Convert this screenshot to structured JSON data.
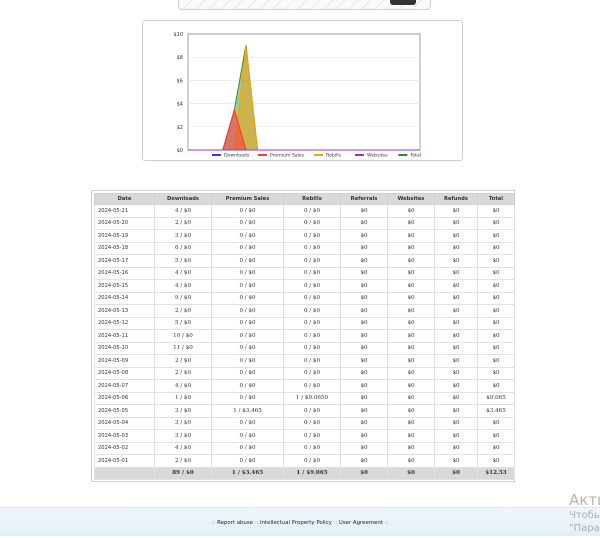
{
  "chart_data": {
    "type": "area",
    "x": [
      "2024-05-01",
      "2024-05-02",
      "2024-05-03",
      "2024-05-04",
      "2024-05-05",
      "2024-05-06",
      "2024-05-07",
      "2024-05-08",
      "2024-05-09",
      "2024-05-10",
      "2024-05-11",
      "2024-05-12",
      "2024-05-13",
      "2024-05-14",
      "2024-05-15",
      "2024-05-16",
      "2024-05-17",
      "2024-05-18",
      "2024-05-19",
      "2024-05-20",
      "2024-05-21"
    ],
    "series": [
      {
        "name": "Downloads",
        "color": "#3333ff",
        "values": [
          0,
          0,
          0,
          0,
          0,
          0,
          0,
          0,
          0,
          0,
          0,
          0,
          0,
          0,
          0,
          0,
          0,
          0,
          0,
          0,
          0
        ]
      },
      {
        "name": "Premium Sales",
        "color": "#ff3333",
        "values": [
          0,
          0,
          0,
          0,
          3.465,
          0,
          0,
          0,
          0,
          0,
          0,
          0,
          0,
          0,
          0,
          0,
          0,
          0,
          0,
          0,
          0
        ]
      },
      {
        "name": "Rebills",
        "color": "#f0a30a",
        "values": [
          0,
          0,
          0,
          0,
          0,
          9.065,
          0,
          0,
          0,
          0,
          0,
          0,
          0,
          0,
          0,
          0,
          0,
          0,
          0,
          0,
          0
        ]
      },
      {
        "name": "Websites",
        "color": "#9933cc",
        "values": [
          0,
          0,
          0,
          0,
          0,
          0,
          0,
          0,
          0,
          0,
          0,
          0,
          0,
          0,
          0,
          0,
          0,
          0,
          0,
          0,
          0
        ]
      },
      {
        "name": "Total",
        "color": "#2e8b2e",
        "values": [
          0,
          0,
          0,
          0,
          3.465,
          9.065,
          0,
          0,
          0,
          0,
          0,
          0,
          0,
          0,
          0,
          0,
          0,
          0,
          0,
          0,
          0
        ]
      }
    ],
    "yticks": [
      "$0",
      "$2",
      "$4",
      "$6",
      "$8",
      "$10"
    ],
    "ylim": [
      0,
      10
    ],
    "legend_position": "bottom"
  },
  "table": {
    "headers": [
      "Date",
      "Downloads",
      "Premium Sales",
      "Rebills",
      "Referrals",
      "Websites",
      "Refunds",
      "Total"
    ],
    "rows": [
      [
        "2024-05-21",
        "4 / $0",
        "0 / $0",
        "0 / $0",
        "$0",
        "$0",
        "$0",
        "$0"
      ],
      [
        "2024-05-20",
        "2 / $0",
        "0 / $0",
        "0 / $0",
        "$0",
        "$0",
        "$0",
        "$0"
      ],
      [
        "2024-05-19",
        "3 / $0",
        "0 / $0",
        "0 / $0",
        "$0",
        "$0",
        "$0",
        "$0"
      ],
      [
        "2024-05-18",
        "6 / $0",
        "0 / $0",
        "0 / $0",
        "$0",
        "$0",
        "$0",
        "$0"
      ],
      [
        "2024-05-17",
        "5 / $0",
        "0 / $0",
        "0 / $0",
        "$0",
        "$0",
        "$0",
        "$0"
      ],
      [
        "2024-05-16",
        "4 / $0",
        "0 / $0",
        "0 / $0",
        "$0",
        "$0",
        "$0",
        "$0"
      ],
      [
        "2024-05-15",
        "4 / $0",
        "0 / $0",
        "0 / $0",
        "$0",
        "$0",
        "$0",
        "$0"
      ],
      [
        "2024-05-14",
        "9 / $0",
        "0 / $0",
        "0 / $0",
        "$0",
        "$0",
        "$0",
        "$0"
      ],
      [
        "2024-05-13",
        "2 / $0",
        "0 / $0",
        "0 / $0",
        "$0",
        "$0",
        "$0",
        "$0"
      ],
      [
        "2024-05-12",
        "5 / $0",
        "0 / $0",
        "0 / $0",
        "$0",
        "$0",
        "$0",
        "$0"
      ],
      [
        "2024-05-11",
        "10 / $0",
        "0 / $0",
        "0 / $0",
        "$0",
        "$0",
        "$0",
        "$0"
      ],
      [
        "2024-05-10",
        "11 / $0",
        "0 / $0",
        "0 / $0",
        "$0",
        "$0",
        "$0",
        "$0"
      ],
      [
        "2024-05-09",
        "2 / $0",
        "0 / $0",
        "0 / $0",
        "$0",
        "$0",
        "$0",
        "$0"
      ],
      [
        "2024-05-08",
        "2 / $0",
        "0 / $0",
        "0 / $0",
        "$0",
        "$0",
        "$0",
        "$0"
      ],
      [
        "2024-05-07",
        "4 / $0",
        "0 / $0",
        "0 / $0",
        "$0",
        "$0",
        "$0",
        "$0"
      ],
      [
        "2024-05-06",
        "1 / $0",
        "0 / $0",
        "1 / $9.0650",
        "$0",
        "$0",
        "$0",
        "$9.065"
      ],
      [
        "2024-05-05",
        "3 / $0",
        "1 / $3.465",
        "0 / $0",
        "$0",
        "$0",
        "$0",
        "$3.465"
      ],
      [
        "2024-05-04",
        "3 / $0",
        "0 / $0",
        "0 / $0",
        "$0",
        "$0",
        "$0",
        "$0"
      ],
      [
        "2024-05-03",
        "3 / $0",
        "0 / $0",
        "0 / $0",
        "$0",
        "$0",
        "$0",
        "$0"
      ],
      [
        "2024-05-02",
        "4 / $0",
        "0 / $0",
        "0 / $0",
        "$0",
        "$0",
        "$0",
        "$0"
      ],
      [
        "2024-05-01",
        "2 / $0",
        "0 / $0",
        "0 / $0",
        "$0",
        "$0",
        "$0",
        "$0"
      ]
    ],
    "totals": [
      "",
      "89 / $0",
      "1 / $3.465",
      "1 / $9.065",
      "$0",
      "$0",
      "$0",
      "$12.53"
    ]
  },
  "footer": {
    "sep": "::",
    "links": [
      "Report abuse",
      "Intellectual Property Policy",
      "User Agreement"
    ]
  },
  "watermark": {
    "line1": "Акти",
    "line2": "Чтобы",
    "line3": "\"Пара"
  }
}
